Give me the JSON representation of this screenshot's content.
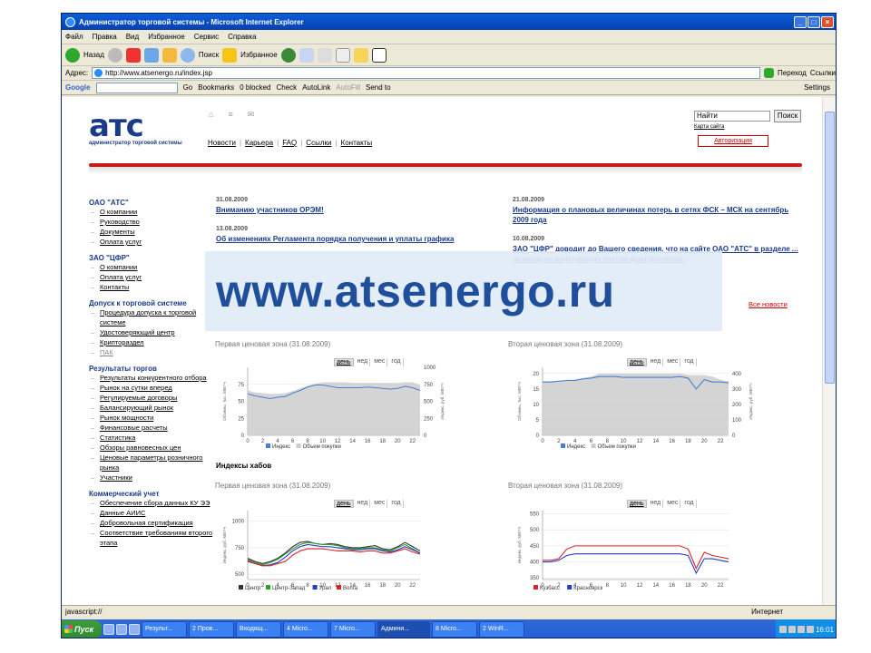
{
  "window": {
    "title": "Администратор торговой системы - Microsoft Internet Explorer"
  },
  "menu": [
    "Файл",
    "Правка",
    "Вид",
    "Избранное",
    "Сервис",
    "Справка"
  ],
  "toolbar": {
    "back": "Назад",
    "search": "Поиск",
    "favorites": "Избранное"
  },
  "address": {
    "label": "Адрес:",
    "url": "http://www.atsenergo.ru/index.jsp",
    "go": "Переход",
    "links": "Ссылки"
  },
  "google": {
    "go": "Go",
    "bookmarks": "Bookmarks",
    "blocked": "0 blocked",
    "check": "Check",
    "autolink": "AutoLink",
    "autofill": "AutoFill",
    "sendto": "Send to",
    "settings": "Settings"
  },
  "page": {
    "logo_main": "атс",
    "logo_sub": "администратор торговой системы",
    "topnav": [
      "Новости",
      "Карьера",
      "FAQ",
      "Ссылки",
      "Контакты"
    ],
    "search_value": "Найти",
    "search_btn": "Поиск",
    "sitemap": "Карта сайта",
    "auth": "Авторизация",
    "overlay": "www.atsenergo.ru",
    "sidebar": [
      {
        "head": "ОАО \"АТС\"",
        "items": [
          "О компании",
          "Руководство",
          "Документы",
          "Оплата услуг"
        ]
      },
      {
        "head": "ЗАО \"ЦФР\"",
        "items": [
          "О компании",
          "Оплата услуг",
          "Контакты"
        ]
      },
      {
        "head": "Допуск к торговой системе",
        "items": [
          "Процедура допуска к торговой системе",
          "Удостоверяющий центр",
          "Криптораздел",
          "ПАК"
        ]
      },
      {
        "head": "Результаты торгов",
        "items": [
          "Результаты конкурентного отбора",
          "Рынок на сутки вперед",
          "Регулируемые договоры",
          "Балансирующий рынок",
          "Рынок мощности",
          "Финансовые расчеты",
          "Статистика",
          "Обзоры равновесных цен",
          "Ценовые параметры розничного рынка",
          "Участники"
        ]
      },
      {
        "head": "Коммерческий учет",
        "items": [
          "Обеспечение сбора данных КУ ЭЭ",
          "Данные АИИС",
          "Добровольная сертификация",
          "Соответствие требованиям второго этапа"
        ]
      }
    ],
    "news_left": [
      {
        "date": "31.08.2009",
        "title": "Вниманию участников ОРЭМ!"
      },
      {
        "date": "13.08.2009",
        "title": "Об изменениях Регламента порядка получения и уплаты графика"
      }
    ],
    "news_right": [
      {
        "date": "21.08.2009",
        "title": "Информация о плановых величинах потерь в сетях ФСК – МСК на сентябрь 2009 года"
      },
      {
        "date": "10.08.2009",
        "title": "ЗАО \"ЦФР\" доводит до Вашего сведения, что на сайте ОАО \"АТС\" в разделе ... размещена информация счетов-фактур/счетов-"
      }
    ],
    "all_news": "Все новости",
    "tabs": [
      "день",
      "нед",
      "мес",
      "год"
    ],
    "hubs_title": "Индексы хабов",
    "status_left": "javascript://",
    "status_zone": "Интернет"
  },
  "taskbar": {
    "start": "Пуск",
    "tasks": [
      "Результ...",
      "2 Пров...",
      "Входящ...",
      "4 Micro...",
      "7 Micro...",
      "Админи...",
      "8 Micro...",
      "2 WinR..."
    ],
    "clock": "16:01"
  },
  "chart_data": [
    {
      "type": "line",
      "title": "Первая ценовая зона (31.08.2009)",
      "x": [
        0,
        1,
        2,
        3,
        4,
        5,
        6,
        7,
        8,
        9,
        10,
        11,
        12,
        13,
        14,
        15,
        16,
        17,
        18,
        19,
        20,
        21,
        22,
        23
      ],
      "ylabel": "Объемы, тыс. МВт*ч",
      "y2label": "Индекс, руб. МВт*ч",
      "ylim": [
        0,
        100
      ],
      "y2lim": [
        0,
        1000
      ],
      "xticks": [
        0,
        2,
        4,
        6,
        8,
        10,
        12,
        14,
        16,
        18,
        20,
        22
      ],
      "yticks": [
        0,
        25,
        50,
        75
      ],
      "y2ticks": [
        0,
        250,
        500,
        750,
        1000
      ],
      "series": [
        {
          "name": "Индекс",
          "axis": "y2",
          "values": [
            610,
            580,
            560,
            540,
            560,
            570,
            620,
            660,
            710,
            740,
            740,
            720,
            700,
            700,
            700,
            700,
            710,
            700,
            690,
            680,
            690,
            720,
            700,
            660
          ]
        },
        {
          "name": "Объем покупки",
          "type": "area",
          "axis": "y",
          "values": [
            66,
            63,
            62,
            61,
            61,
            62,
            65,
            69,
            73,
            76,
            78,
            78,
            78,
            78,
            77,
            77,
            77,
            77,
            77,
            77,
            77,
            78,
            78,
            74
          ]
        }
      ]
    },
    {
      "type": "line",
      "title": "Вторая ценовая зона (31.08.2009)",
      "x": [
        0,
        1,
        2,
        3,
        4,
        5,
        6,
        7,
        8,
        9,
        10,
        11,
        12,
        13,
        14,
        15,
        16,
        17,
        18,
        19,
        20,
        21,
        22,
        23
      ],
      "ylabel": "Объемы, тыс. МВт*ч",
      "y2label": "Индекс, руб. МВт*ч",
      "ylim": [
        0,
        22
      ],
      "y2lim": [
        0,
        440
      ],
      "xticks": [
        0,
        2,
        4,
        6,
        8,
        10,
        12,
        14,
        16,
        18,
        20,
        22
      ],
      "yticks": [
        0,
        5,
        10,
        15,
        20
      ],
      "y2ticks": [
        0,
        100,
        200,
        300,
        400
      ],
      "series": [
        {
          "name": "Индекс",
          "axis": "y2",
          "values": [
            345,
            345,
            350,
            355,
            355,
            365,
            370,
            380,
            380,
            380,
            375,
            375,
            375,
            375,
            375,
            375,
            375,
            380,
            370,
            300,
            360,
            345,
            345,
            340
          ]
        },
        {
          "name": "Объем покупки",
          "type": "area",
          "axis": "y",
          "values": [
            17.5,
            17.5,
            17.5,
            18,
            18,
            18.5,
            19,
            20,
            20,
            20,
            20,
            20,
            20,
            20,
            20,
            20,
            20,
            20,
            19.5,
            19.5,
            19.5,
            19,
            18,
            17.5
          ]
        }
      ]
    },
    {
      "type": "line",
      "title": "Первая ценовая зона (31.08.2009)",
      "x": [
        0,
        1,
        2,
        3,
        4,
        5,
        6,
        7,
        8,
        9,
        10,
        11,
        12,
        13,
        14,
        15,
        16,
        17,
        18,
        19,
        20,
        21,
        22,
        23
      ],
      "ylabel": "Индекс, руб. МВт*ч",
      "ylim": [
        450,
        1100
      ],
      "yticks": [
        500,
        750,
        1000
      ],
      "xticks": [
        0,
        2,
        4,
        6,
        8,
        10,
        12,
        14,
        16,
        18,
        20,
        22
      ],
      "series": [
        {
          "name": "Центр",
          "color": "#333333",
          "values": [
            650,
            620,
            600,
            620,
            650,
            700,
            760,
            800,
            810,
            790,
            780,
            790,
            780,
            760,
            750,
            750,
            760,
            770,
            740,
            730,
            760,
            800,
            760,
            720
          ]
        },
        {
          "name": "Центр-Запад",
          "color": "#2ca02c",
          "values": [
            640,
            610,
            590,
            610,
            640,
            690,
            740,
            780,
            800,
            790,
            780,
            780,
            770,
            750,
            740,
            740,
            750,
            750,
            730,
            720,
            750,
            780,
            740,
            700
          ]
        },
        {
          "name": "Урал",
          "color": "#1f3fbf",
          "values": [
            620,
            600,
            580,
            590,
            610,
            660,
            720,
            760,
            780,
            770,
            760,
            760,
            750,
            740,
            730,
            730,
            740,
            740,
            720,
            710,
            730,
            760,
            730,
            700
          ]
        },
        {
          "name": "Волга",
          "color": "#d62728",
          "values": [
            630,
            600,
            580,
            580,
            600,
            620,
            680,
            720,
            740,
            740,
            740,
            730,
            720,
            720,
            720,
            710,
            720,
            720,
            700,
            700,
            720,
            740,
            710,
            690
          ]
        }
      ]
    },
    {
      "type": "line",
      "title": "Вторая ценовая зона (31.08.2009)",
      "x": [
        0,
        1,
        2,
        3,
        4,
        5,
        6,
        7,
        8,
        9,
        10,
        11,
        12,
        13,
        14,
        15,
        16,
        17,
        18,
        19,
        20,
        21,
        22,
        23
      ],
      "ylabel": "Индекс, руб. МВт*ч",
      "ylim": [
        345,
        560
      ],
      "yticks": [
        350,
        400,
        450,
        500,
        550
      ],
      "xticks": [
        0,
        2,
        4,
        6,
        8,
        10,
        12,
        14,
        16,
        18,
        20,
        22
      ],
      "series": [
        {
          "name": "Кузбасс",
          "color": "#d62728",
          "values": [
            405,
            405,
            410,
            440,
            450,
            450,
            450,
            450,
            450,
            450,
            450,
            450,
            450,
            450,
            450,
            450,
            450,
            450,
            440,
            380,
            430,
            420,
            415,
            410
          ]
        },
        {
          "name": "Красноярск",
          "color": "#1f3fbf",
          "values": [
            400,
            400,
            405,
            420,
            425,
            425,
            425,
            425,
            425,
            425,
            425,
            425,
            425,
            425,
            425,
            425,
            425,
            425,
            420,
            365,
            410,
            410,
            405,
            400
          ]
        }
      ]
    }
  ],
  "colors": {
    "brand_blue": "#1a3a8a",
    "brand_red": "#c41a1a",
    "index_line": "#4a7fd8",
    "volume_area": "#cccccc"
  }
}
